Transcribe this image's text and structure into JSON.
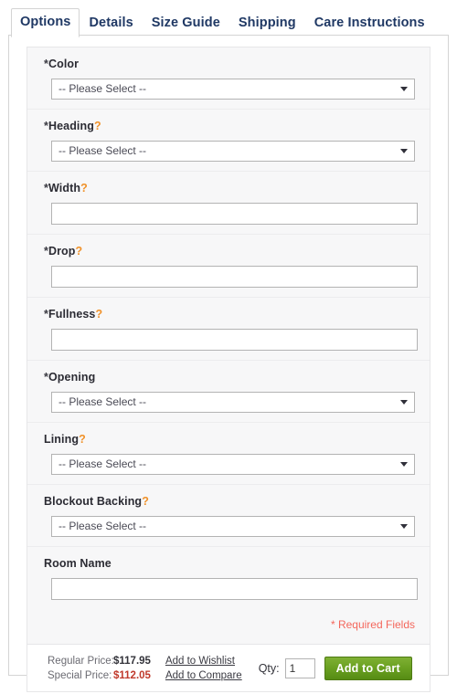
{
  "tabs": [
    {
      "label": "Options",
      "active": true
    },
    {
      "label": "Details",
      "active": false
    },
    {
      "label": "Size Guide",
      "active": false
    },
    {
      "label": "Shipping",
      "active": false
    },
    {
      "label": "Care Instructions",
      "active": false
    }
  ],
  "form": {
    "fields": [
      {
        "label": "Color",
        "required": true,
        "help": false,
        "type": "select",
        "value": "-- Please Select --"
      },
      {
        "label": "Heading",
        "required": true,
        "help": true,
        "type": "select",
        "value": "-- Please Select --"
      },
      {
        "label": "Width",
        "required": true,
        "help": true,
        "type": "text",
        "value": ""
      },
      {
        "label": "Drop",
        "required": true,
        "help": true,
        "type": "text",
        "value": ""
      },
      {
        "label": "Fullness",
        "required": true,
        "help": true,
        "type": "text",
        "value": ""
      },
      {
        "label": "Opening",
        "required": true,
        "help": false,
        "type": "select",
        "value": "-- Please Select --"
      },
      {
        "label": "Lining",
        "required": false,
        "help": true,
        "type": "select",
        "value": "-- Please Select --"
      },
      {
        "label": "Blockout Backing",
        "required": false,
        "help": true,
        "type": "select",
        "value": "-- Please Select --"
      },
      {
        "label": "Room Name",
        "required": false,
        "help": false,
        "type": "text",
        "value": ""
      }
    ],
    "required_note": "* Required Fields",
    "required_marker": "*",
    "help_marker": "?",
    "select_placeholder": "-- Please Select --"
  },
  "footer": {
    "regular_price_label": "Regular Price:",
    "regular_price_value": "$117.95",
    "special_price_label": "Special Price:",
    "special_price_value": "$112.05",
    "wishlist_link": "Add to Wishlist",
    "compare_link": "Add to Compare",
    "qty_label": "Qty:",
    "qty_value": "1",
    "add_to_cart_label": "Add to Cart"
  },
  "colors": {
    "tab_text": "#1f3864",
    "help_orange": "#f0922b",
    "required_red": "#f4675c",
    "special_price_red": "#c0392b",
    "cart_green": "#6aa021",
    "form_bg": "#f7f7f8"
  }
}
